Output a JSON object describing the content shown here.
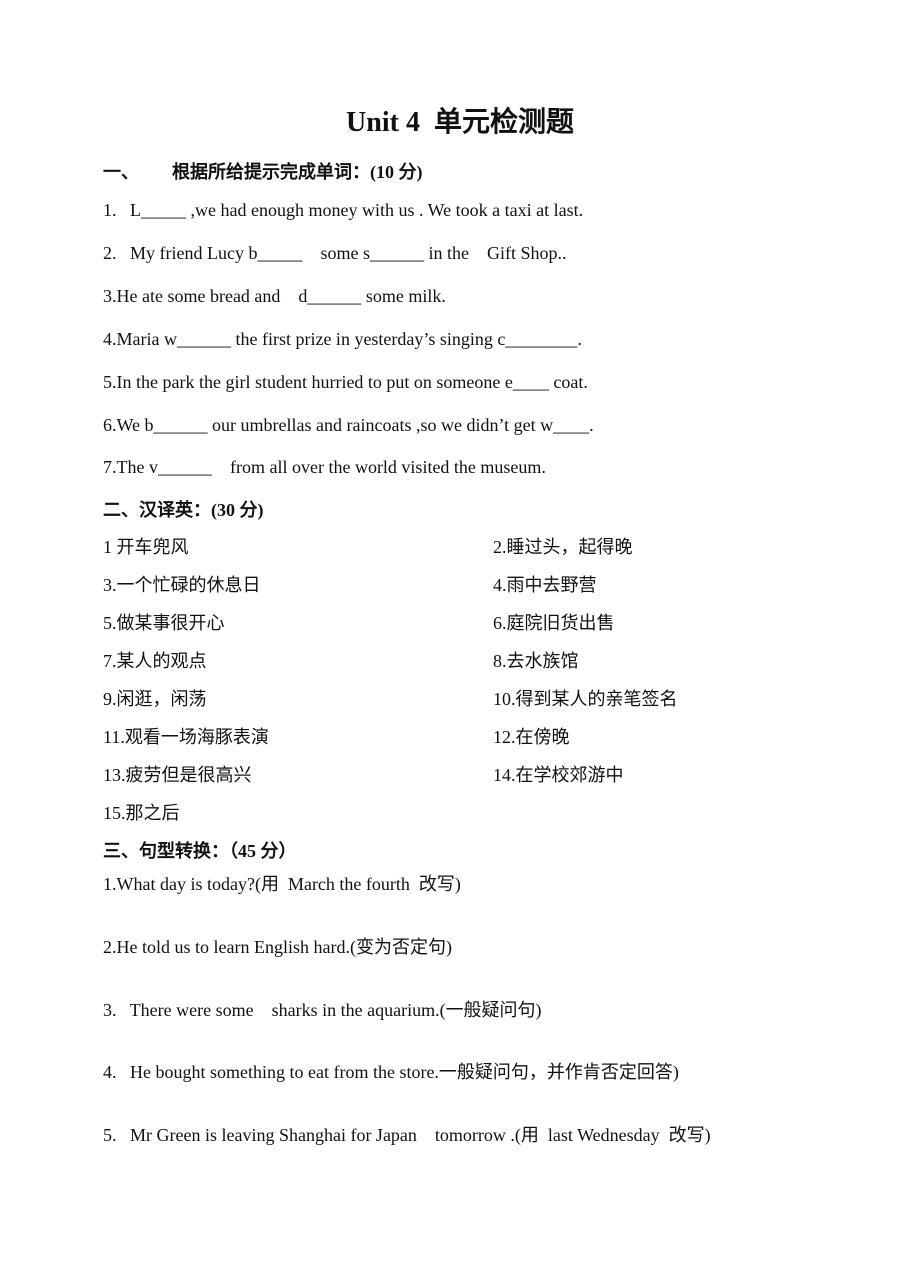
{
  "title": "Unit 4  单元检测题",
  "section1": {
    "heading_num": "一、",
    "heading": "根据所给提示完成单词：(10 分)",
    "items": [
      "1.   L_____ ,we had enough money with us . We took a taxi at last.",
      "2.   My friend Lucy b_____    some s______ in the    Gift Shop..",
      "3.He ate some bread and    d______ some milk.",
      "4.Maria w______ the first prize in yesterday’s singing c________.",
      "5.In the park the girl student hurried to put on someone e____ coat.",
      "6.We b______ our umbrellas and raincoats ,so we didn’t get w____.",
      "7.The v______    from all over the world visited the museum."
    ]
  },
  "section2": {
    "heading": "二、汉译英：(30 分)",
    "left": [
      "1 开车兜风",
      "3.一个忙碌的休息日",
      "5.做某事很开心",
      "7.某人的观点",
      "9.闲逛，闲荡",
      "11.观看一场海豚表演",
      "13.疲劳但是很高兴",
      "15.那之后"
    ],
    "right": [
      "2.睡过头，起得晚",
      "4.雨中去野营",
      "6.庭院旧货出售",
      "8.去水族馆",
      "10.得到某人的亲笔签名",
      "12.在傍晚",
      "14.在学校郊游中"
    ]
  },
  "section3": {
    "heading": "三、句型转换：（45 分）",
    "items": [
      "1.What day is today?(用  March the fourth  改写)",
      "2.He told us to learn English hard.(变为否定句)",
      "3.   There were some    sharks in the aquarium.(一般疑问句)",
      "4.   He bought something to eat from the store.一般疑问句，并作肯否定回答)",
      "5.   Mr Green is leaving Shanghai for Japan    tomorrow .(用  last Wednesday  改写)"
    ]
  }
}
